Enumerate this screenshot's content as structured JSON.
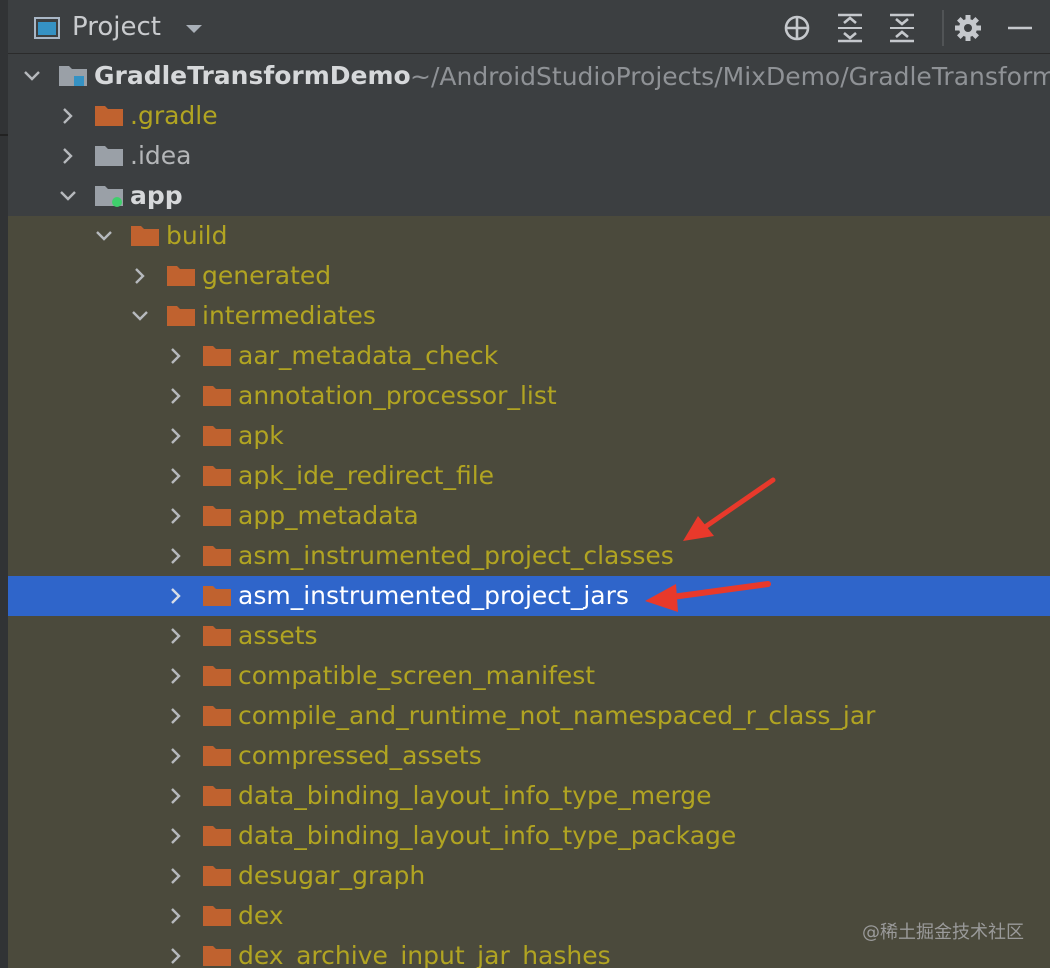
{
  "panel": {
    "title": "Project"
  },
  "tree": {
    "root": {
      "name": "GradleTransformDemo",
      "path": "~/AndroidStudioProjects/MixDemo/GradleTransformDemo"
    },
    "items": [
      {
        "label": ".gradle"
      },
      {
        "label": ".idea"
      },
      {
        "label": "app"
      },
      {
        "label": "build"
      },
      {
        "label": "generated"
      },
      {
        "label": "intermediates"
      },
      {
        "label": "aar_metadata_check"
      },
      {
        "label": "annotation_processor_list"
      },
      {
        "label": "apk"
      },
      {
        "label": "apk_ide_redirect_file"
      },
      {
        "label": "app_metadata"
      },
      {
        "label": "asm_instrumented_project_classes"
      },
      {
        "label": "asm_instrumented_project_jars"
      },
      {
        "label": "assets"
      },
      {
        "label": "compatible_screen_manifest"
      },
      {
        "label": "compile_and_runtime_not_namespaced_r_class_jar"
      },
      {
        "label": "compressed_assets"
      },
      {
        "label": "data_binding_layout_info_type_merge"
      },
      {
        "label": "data_binding_layout_info_type_package"
      },
      {
        "label": "desugar_graph"
      },
      {
        "label": "dex"
      },
      {
        "label": "dex_archive_input_jar_hashes"
      }
    ]
  },
  "colors": {
    "selection": "#2f65ca",
    "folder": "#c0622f",
    "excluded_bg": "#4b4a3c",
    "excluded_text": "#b1a422",
    "annotation_arrow": "#e8392b"
  },
  "watermark": "@稀土掘金技术社区"
}
